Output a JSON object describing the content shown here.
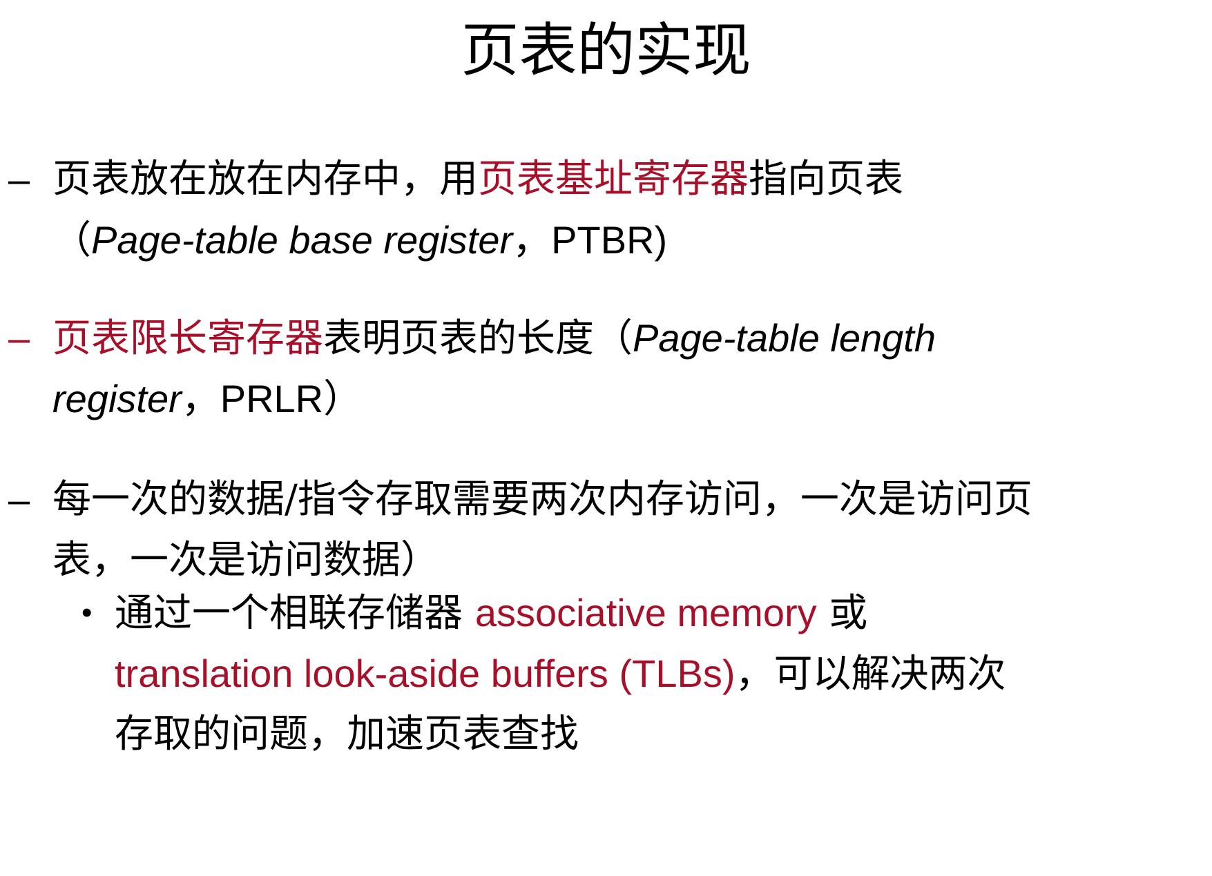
{
  "title": "页表的实现",
  "items": [
    {
      "marker": "–",
      "line1": {
        "a": "页表放在放在内存中，用",
        "b": "页表基址寄存器",
        "c": "指向页表"
      },
      "line2": {
        "a": "（",
        "b": "Page-table base register",
        "c": "，",
        "d": "PTBR)"
      }
    },
    {
      "marker": "–",
      "line1": {
        "a": "页表限长寄存器",
        "b": "表明页表的长度（",
        "c": "Page-table length"
      },
      "line2": {
        "a": "register",
        "b": "，",
        "c": "PRLR",
        "d": "）"
      }
    },
    {
      "marker": "–",
      "line1": "每一次的数据/指令存取需要两次内存访问，一次是访问页",
      "line2": "表，一次是访问数据）"
    }
  ],
  "subitem": {
    "marker": "•",
    "line1": {
      "a": "通过一个相联存储器 ",
      "b": "associative memory",
      "c": " 或"
    },
    "line2": {
      "a": "translation look-aside buffers (TLBs)",
      "b": "，可以解决两次"
    },
    "line3": "存取的问题，加速页表查找"
  },
  "colors": {
    "highlight": "#a8102a",
    "text": "#000000",
    "background": "#ffffff"
  }
}
